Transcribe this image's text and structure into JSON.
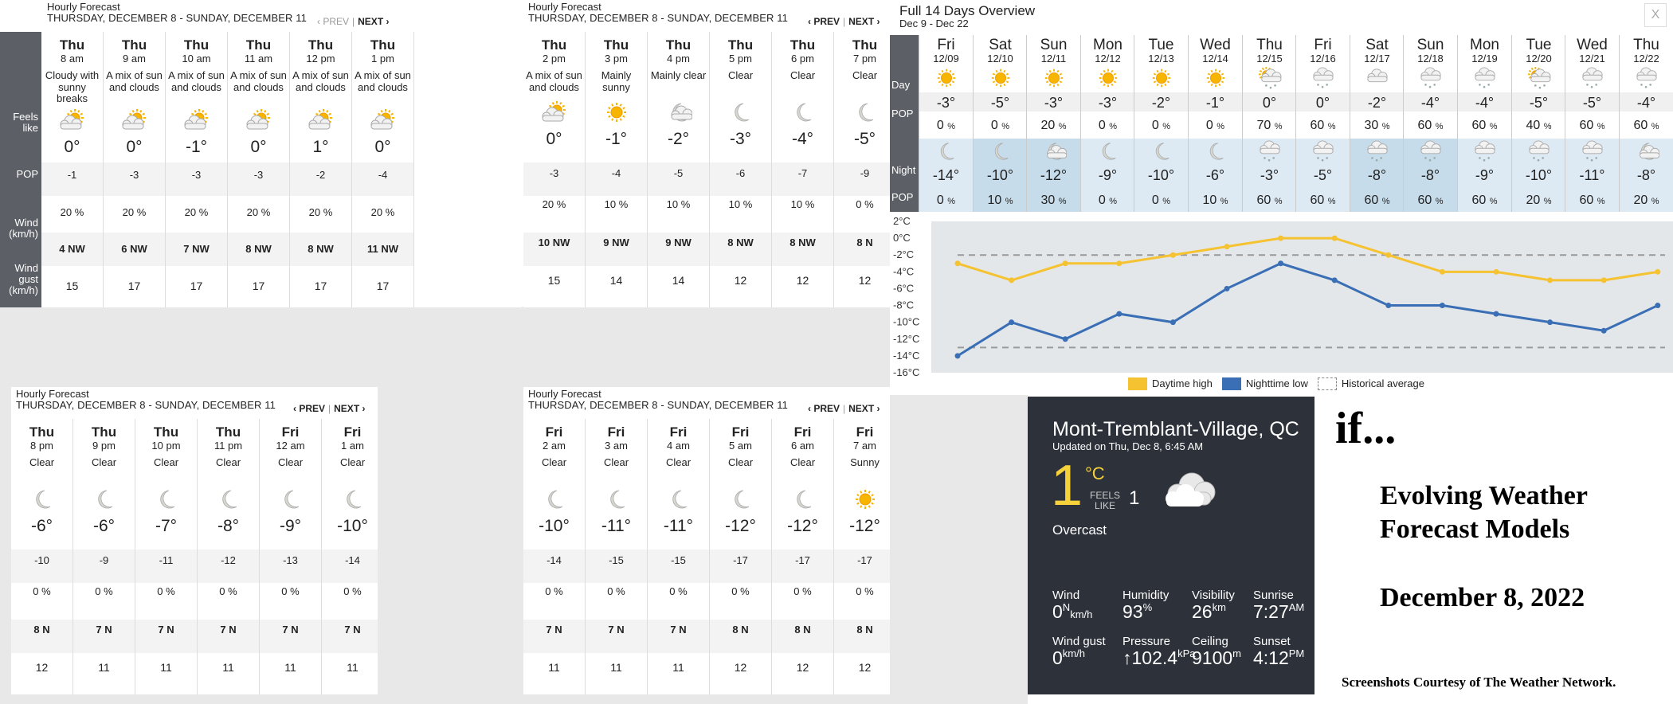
{
  "hourly": {
    "title": "Hourly Forecast",
    "range": "THURSDAY, DECEMBER 8 - SUNDAY, DECEMBER 11",
    "prev": "‹ PREV",
    "separator": "|",
    "next": "NEXT ›",
    "labels": {
      "feels": "Feels like",
      "pop": "POP",
      "wind": "Wind (km/h)",
      "gust": "Wind gust (km/h)"
    },
    "panels": [
      {
        "prev_active": false,
        "columns": [
          {
            "day": "Thu",
            "hour": "8 am",
            "cond": "Cloudy with sunny breaks",
            "icon": "partly-cloudy-icon",
            "temp": "0°",
            "feels": "-1",
            "pop": "20 %",
            "wind": "4",
            "dir": "NW",
            "gust": "15"
          },
          {
            "day": "Thu",
            "hour": "9 am",
            "cond": "A mix of sun and clouds",
            "icon": "partly-cloudy-icon",
            "temp": "0°",
            "feels": "-3",
            "pop": "20 %",
            "wind": "6",
            "dir": "NW",
            "gust": "17"
          },
          {
            "day": "Thu",
            "hour": "10 am",
            "cond": "A mix of sun and clouds",
            "icon": "partly-cloudy-icon",
            "temp": "-1°",
            "feels": "-3",
            "pop": "20 %",
            "wind": "7",
            "dir": "NW",
            "gust": "17"
          },
          {
            "day": "Thu",
            "hour": "11 am",
            "cond": "A mix of sun and clouds",
            "icon": "partly-cloudy-icon",
            "temp": "0°",
            "feels": "-3",
            "pop": "20 %",
            "wind": "8",
            "dir": "NW",
            "gust": "17"
          },
          {
            "day": "Thu",
            "hour": "12 pm",
            "cond": "A mix of sun and clouds",
            "icon": "partly-cloudy-icon",
            "temp": "1°",
            "feels": "-2",
            "pop": "20 %",
            "wind": "8",
            "dir": "NW",
            "gust": "17"
          },
          {
            "day": "Thu",
            "hour": "1 pm",
            "cond": "A mix of sun and clouds",
            "icon": "partly-cloudy-icon",
            "temp": "0°",
            "feels": "-4",
            "pop": "20 %",
            "wind": "11",
            "dir": "NW",
            "gust": "17"
          }
        ]
      },
      {
        "prev_active": true,
        "columns": [
          {
            "day": "Thu",
            "hour": "2 pm",
            "cond": "A mix of sun and clouds",
            "icon": "partly-cloudy-icon",
            "temp": "0°",
            "feels": "-3",
            "pop": "20 %",
            "wind": "10",
            "dir": "NW",
            "gust": "15"
          },
          {
            "day": "Thu",
            "hour": "3 pm",
            "cond": "Mainly sunny",
            "icon": "sun-icon",
            "temp": "-1°",
            "feels": "-4",
            "pop": "10 %",
            "wind": "9",
            "dir": "NW",
            "gust": "14"
          },
          {
            "day": "Thu",
            "hour": "4 pm",
            "cond": "Mainly clear",
            "icon": "moon-cloud-icon",
            "temp": "-2°",
            "feels": "-5",
            "pop": "10 %",
            "wind": "9",
            "dir": "NW",
            "gust": "14"
          },
          {
            "day": "Thu",
            "hour": "5 pm",
            "cond": "Clear",
            "icon": "moon-icon",
            "temp": "-3°",
            "feels": "-6",
            "pop": "10 %",
            "wind": "8",
            "dir": "NW",
            "gust": "12"
          },
          {
            "day": "Thu",
            "hour": "6 pm",
            "cond": "Clear",
            "icon": "moon-icon",
            "temp": "-4°",
            "feels": "-7",
            "pop": "10 %",
            "wind": "8",
            "dir": "NW",
            "gust": "12"
          },
          {
            "day": "Thu",
            "hour": "7 pm",
            "cond": "Clear",
            "icon": "moon-icon",
            "temp": "-5°",
            "feels": "-9",
            "pop": "0 %",
            "wind": "8",
            "dir": "N",
            "gust": "12"
          }
        ]
      },
      {
        "prev_active": true,
        "columns": [
          {
            "day": "Thu",
            "hour": "8 pm",
            "cond": "Clear",
            "icon": "moon-icon",
            "temp": "-6°",
            "feels": "-10",
            "pop": "0 %",
            "wind": "8",
            "dir": "N",
            "gust": "12"
          },
          {
            "day": "Thu",
            "hour": "9 pm",
            "cond": "Clear",
            "icon": "moon-icon",
            "temp": "-6°",
            "feels": "-9",
            "pop": "0 %",
            "wind": "7",
            "dir": "N",
            "gust": "11"
          },
          {
            "day": "Thu",
            "hour": "10 pm",
            "cond": "Clear",
            "icon": "moon-icon",
            "temp": "-7°",
            "feels": "-11",
            "pop": "0 %",
            "wind": "7",
            "dir": "N",
            "gust": "11"
          },
          {
            "day": "Thu",
            "hour": "11 pm",
            "cond": "Clear",
            "icon": "moon-icon",
            "temp": "-8°",
            "feels": "-12",
            "pop": "0 %",
            "wind": "7",
            "dir": "N",
            "gust": "11"
          },
          {
            "day": "Fri",
            "hour": "12 am",
            "cond": "Clear",
            "icon": "moon-icon",
            "temp": "-9°",
            "feels": "-13",
            "pop": "0 %",
            "wind": "7",
            "dir": "N",
            "gust": "11"
          },
          {
            "day": "Fri",
            "hour": "1 am",
            "cond": "Clear",
            "icon": "moon-icon",
            "temp": "-10°",
            "feels": "-14",
            "pop": "0 %",
            "wind": "7",
            "dir": "N",
            "gust": "11"
          }
        ]
      },
      {
        "prev_active": true,
        "columns": [
          {
            "day": "Fri",
            "hour": "2 am",
            "cond": "Clear",
            "icon": "moon-icon",
            "temp": "-10°",
            "feels": "-14",
            "pop": "0 %",
            "wind": "7",
            "dir": "N",
            "gust": "11"
          },
          {
            "day": "Fri",
            "hour": "3 am",
            "cond": "Clear",
            "icon": "moon-icon",
            "temp": "-11°",
            "feels": "-15",
            "pop": "0 %",
            "wind": "7",
            "dir": "N",
            "gust": "11"
          },
          {
            "day": "Fri",
            "hour": "4 am",
            "cond": "Clear",
            "icon": "moon-icon",
            "temp": "-11°",
            "feels": "-15",
            "pop": "0 %",
            "wind": "7",
            "dir": "N",
            "gust": "11"
          },
          {
            "day": "Fri",
            "hour": "5 am",
            "cond": "Clear",
            "icon": "moon-icon",
            "temp": "-12°",
            "feels": "-17",
            "pop": "0 %",
            "wind": "8",
            "dir": "N",
            "gust": "12"
          },
          {
            "day": "Fri",
            "hour": "6 am",
            "cond": "Clear",
            "icon": "moon-icon",
            "temp": "-12°",
            "feels": "-17",
            "pop": "0 %",
            "wind": "8",
            "dir": "N",
            "gust": "12"
          },
          {
            "day": "Fri",
            "hour": "7 am",
            "cond": "Sunny",
            "icon": "sun-icon",
            "temp": "-12°",
            "feels": "-17",
            "pop": "0 %",
            "wind": "8",
            "dir": "N",
            "gust": "12"
          }
        ]
      }
    ]
  },
  "overview": {
    "title": "Full 14 Days Overview",
    "range": "Dec 9 - Dec 22",
    "close": "X",
    "labels": {
      "day": "Day",
      "pop": "POP",
      "night": "Night",
      "pop2": "POP"
    },
    "pct": "%",
    "days": [
      {
        "d": "Fri",
        "date": "12/09",
        "day_icon": "sun-icon",
        "hi": "-3°",
        "day_pop": "0",
        "night_icon": "moon-icon",
        "lo": "-14°",
        "night_pop": "0",
        "shade": false
      },
      {
        "d": "Sat",
        "date": "12/10",
        "day_icon": "sun-icon",
        "hi": "-5°",
        "day_pop": "0",
        "night_icon": "moon-icon",
        "lo": "-10°",
        "night_pop": "10",
        "shade": true
      },
      {
        "d": "Sun",
        "date": "12/11",
        "day_icon": "sun-icon",
        "hi": "-3°",
        "day_pop": "20",
        "night_icon": "moon-cloud-icon",
        "lo": "-12°",
        "night_pop": "30",
        "shade": true
      },
      {
        "d": "Mon",
        "date": "12/12",
        "day_icon": "sun-icon",
        "hi": "-3°",
        "day_pop": "0",
        "night_icon": "moon-icon",
        "lo": "-9°",
        "night_pop": "0",
        "shade": false
      },
      {
        "d": "Tue",
        "date": "12/13",
        "day_icon": "sun-icon",
        "hi": "-2°",
        "day_pop": "0",
        "night_icon": "moon-icon",
        "lo": "-10°",
        "night_pop": "0",
        "shade": false
      },
      {
        "d": "Wed",
        "date": "12/14",
        "day_icon": "sun-icon",
        "hi": "-1°",
        "day_pop": "0",
        "night_icon": "moon-icon",
        "lo": "-6°",
        "night_pop": "10",
        "shade": false
      },
      {
        "d": "Thu",
        "date": "12/15",
        "day_icon": "sun-snow-icon",
        "hi": "0°",
        "day_pop": "70",
        "night_icon": "snow-cloud-icon",
        "lo": "-3°",
        "night_pop": "60",
        "shade": false
      },
      {
        "d": "Fri",
        "date": "12/16",
        "day_icon": "snow-cloud-icon",
        "hi": "0°",
        "day_pop": "60",
        "night_icon": "snow-cloud-icon",
        "lo": "-5°",
        "night_pop": "60",
        "shade": false
      },
      {
        "d": "Sat",
        "date": "12/17",
        "day_icon": "cloud-icon",
        "hi": "-2°",
        "day_pop": "30",
        "night_icon": "snow-cloud-icon",
        "lo": "-8°",
        "night_pop": "60",
        "shade": true
      },
      {
        "d": "Sun",
        "date": "12/18",
        "day_icon": "snow-cloud-icon",
        "hi": "-4°",
        "day_pop": "60",
        "night_icon": "snow-cloud-icon",
        "lo": "-8°",
        "night_pop": "60",
        "shade": true
      },
      {
        "d": "Mon",
        "date": "12/19",
        "day_icon": "snow-cloud-icon",
        "hi": "-4°",
        "day_pop": "60",
        "night_icon": "snow-cloud-icon",
        "lo": "-9°",
        "night_pop": "60",
        "shade": false
      },
      {
        "d": "Tue",
        "date": "12/20",
        "day_icon": "sun-snow-icon",
        "hi": "-5°",
        "day_pop": "40",
        "night_icon": "snow-cloud-icon",
        "lo": "-10°",
        "night_pop": "20",
        "shade": false
      },
      {
        "d": "Wed",
        "date": "12/21",
        "day_icon": "snow-cloud-icon",
        "hi": "-5°",
        "day_pop": "60",
        "night_icon": "snow-cloud-icon",
        "lo": "-11°",
        "night_pop": "60",
        "shade": false
      },
      {
        "d": "Thu",
        "date": "12/22",
        "day_icon": "snow-cloud-icon",
        "hi": "-4°",
        "day_pop": "60",
        "night_icon": "moon-cloud-icon",
        "lo": "-8°",
        "night_pop": "20",
        "shade": false
      }
    ]
  },
  "chart_data": {
    "type": "line",
    "x": [
      "12/09",
      "12/10",
      "12/11",
      "12/12",
      "12/13",
      "12/14",
      "12/15",
      "12/16",
      "12/17",
      "12/18",
      "12/19",
      "12/20",
      "12/21",
      "12/22"
    ],
    "series": [
      {
        "name": "Daytime high",
        "color": "#f5c232",
        "values": [
          -3,
          -5,
          -3,
          -3,
          -2,
          -1,
          0,
          0,
          -2,
          -4,
          -4,
          -5,
          -5,
          -4
        ]
      },
      {
        "name": "Nighttime low",
        "color": "#3a6fb5",
        "values": [
          -14,
          -10,
          -12,
          -9,
          -10,
          -6,
          -3,
          -5,
          -8,
          -8,
          -9,
          -10,
          -11,
          -8
        ]
      },
      {
        "name": "Historical average",
        "color": "#999999",
        "values": [
          -2,
          -13
        ]
      }
    ],
    "ylim": [
      -16,
      2
    ],
    "yticks": [
      "2°C",
      "0°C",
      "-2°C",
      "-4°C",
      "-6°C",
      "-8°C",
      "-10°C",
      "-12°C",
      "-14°C",
      "-16°C"
    ],
    "grid": false,
    "legend": "bottom"
  },
  "current": {
    "city": "Mont-Tremblant-Village, QC",
    "updated": "Updated on Thu, Dec 8, 6:45 AM",
    "temp": "1",
    "unit": "°C",
    "feels_label_1": "FEELS",
    "feels_label_2": "LIKE",
    "feels": "1",
    "condition": "Overcast",
    "icon": "cloud-icon",
    "wind": {
      "label": "Wind",
      "value": "0",
      "dir": "N",
      "unit": "km/h"
    },
    "humidity": {
      "label": "Humidity",
      "value": "93",
      "unit": "%"
    },
    "visibility": {
      "label": "Visibility",
      "value": "26",
      "unit": "km"
    },
    "sunrise": {
      "label": "Sunrise",
      "value": "7:27",
      "unit": "AM"
    },
    "gust": {
      "label": "Wind gust",
      "value": "0",
      "unit": "km/h"
    },
    "pressure": {
      "label": "Pressure",
      "value": "↑102.4",
      "unit": "kPa"
    },
    "ceiling": {
      "label": "Ceiling",
      "value": "9100",
      "unit": "m"
    },
    "sunset": {
      "label": "Sunset",
      "value": "4:12",
      "unit": "PM"
    }
  },
  "title_card": {
    "if": "if...",
    "line1": "Evolving Weather",
    "line2": "Forecast Models",
    "date": "December 8, 2022",
    "footer": "Screenshots Courtesy of The Weather Network."
  }
}
